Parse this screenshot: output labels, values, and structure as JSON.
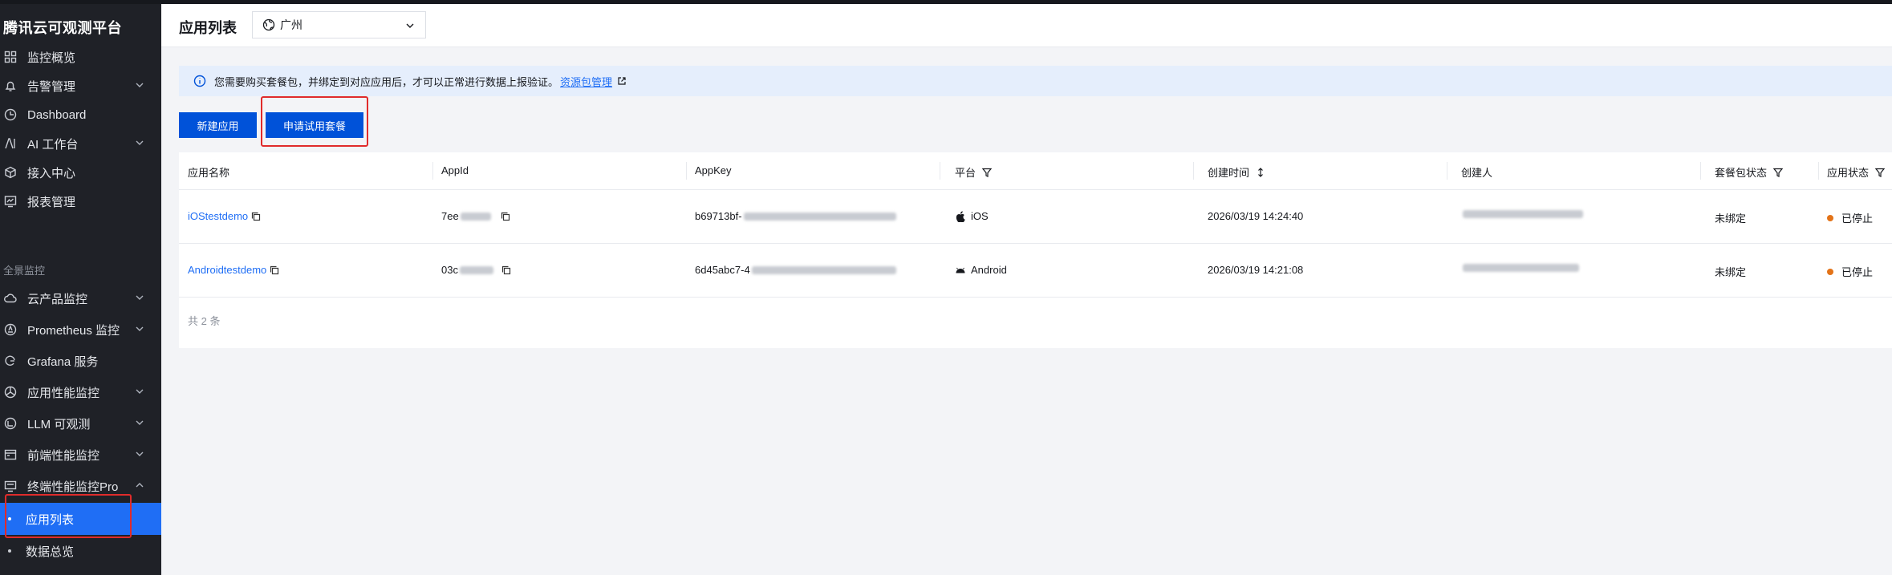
{
  "brand": "腾讯云可观测平台",
  "sidebar": {
    "items": [
      {
        "label": "监控概览",
        "icon": "grid-icon",
        "chevron": false
      },
      {
        "label": "告警管理",
        "icon": "bell-icon",
        "chevron": true
      },
      {
        "label": "Dashboard",
        "icon": "clock-icon",
        "chevron": false
      },
      {
        "label": "AI 工作台",
        "icon": "ai-icon",
        "chevron": true
      },
      {
        "label": "接入中心",
        "icon": "cube-icon",
        "chevron": false
      },
      {
        "label": "报表管理",
        "icon": "report-icon",
        "chevron": false
      }
    ],
    "group_label": "全景监控",
    "group_items": [
      {
        "label": "云产品监控",
        "icon": "cloud-icon",
        "chevron": "down"
      },
      {
        "label": "Prometheus 监控",
        "icon": "prometheus-icon",
        "chevron": "down"
      },
      {
        "label": "Grafana 服务",
        "icon": "grafana-icon",
        "chevron": "none"
      },
      {
        "label": "应用性能监控",
        "icon": "apm-icon",
        "chevron": "down"
      },
      {
        "label": "LLM 可观测",
        "icon": "llm-icon",
        "chevron": "down"
      },
      {
        "label": "前端性能监控",
        "icon": "frontend-icon",
        "chevron": "down"
      },
      {
        "label": "终端性能监控Pro",
        "icon": "terminal-icon",
        "chevron": "up"
      }
    ],
    "sub_items": [
      {
        "label": "应用列表",
        "active": true
      },
      {
        "label": "数据总览",
        "active": false
      }
    ]
  },
  "header": {
    "title": "应用列表",
    "region": "广州"
  },
  "banner": {
    "text": "您需要购买套餐包，并绑定到对应应用后，才可以正常进行数据上报验证。",
    "link": "资源包管理"
  },
  "buttons": {
    "new_app": "新建应用",
    "trial": "申请试用套餐"
  },
  "table": {
    "headers": [
      "应用名称",
      "AppId",
      "AppKey",
      "平台",
      "创建时间",
      "创建人",
      "套餐包状态",
      "应用状态"
    ],
    "rows": [
      {
        "name": "iOStestdemo",
        "appid": "7ee",
        "appkey": "b69713bf-",
        "platform": "iOS",
        "created": "2026/03/19 14:24:40",
        "package": "未绑定",
        "status": "已停止"
      },
      {
        "name": "Androidtestdemo",
        "appid": "03c",
        "appkey": "6d45abc7-4",
        "platform": "Android",
        "created": "2026/03/19 14:21:08",
        "package": "未绑定",
        "status": "已停止"
      }
    ],
    "total": "共 2 条"
  },
  "colors": {
    "sidebar_bg": "#1f2127",
    "active_bg": "#1f6ef5",
    "primary_button": "#0052d9",
    "link": "#1f6ef5",
    "status_stopped": "#e37318",
    "highlight": "#e02b2b"
  }
}
